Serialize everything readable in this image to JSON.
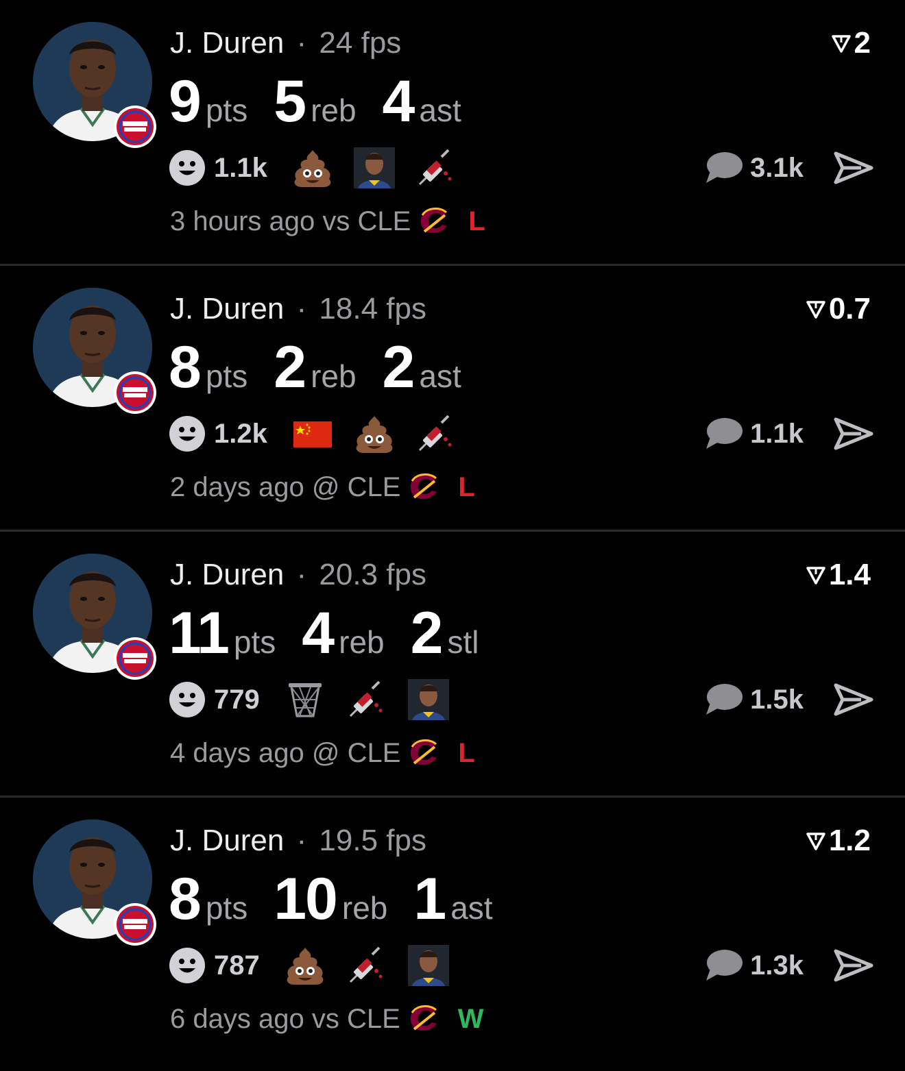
{
  "colors": {
    "loss": "#e0242e",
    "win": "#2fb85a",
    "muted": "#9a9a9f"
  },
  "posts": [
    {
      "player": "J. Duren",
      "fps": "24 fps",
      "rating": "2",
      "stats": [
        {
          "value": "9",
          "label": "pts"
        },
        {
          "value": "5",
          "label": "reb"
        },
        {
          "value": "4",
          "label": "ast"
        }
      ],
      "reaction_count": "1.1k",
      "emojis": [
        "poop-emoji",
        "player-face-emoji",
        "syringe-emoji"
      ],
      "comments": "3.1k",
      "time": "3 hours ago",
      "location": "vs",
      "opponent": "CLE",
      "result": "L",
      "result_type": "loss"
    },
    {
      "player": "J. Duren",
      "fps": "18.4 fps",
      "rating": "0.7",
      "stats": [
        {
          "value": "8",
          "label": "pts"
        },
        {
          "value": "2",
          "label": "reb"
        },
        {
          "value": "2",
          "label": "ast"
        }
      ],
      "reaction_count": "1.2k",
      "emojis": [
        "china-flag-emoji",
        "poop-emoji",
        "syringe-emoji"
      ],
      "comments": "1.1k",
      "time": "2 days ago",
      "location": "@",
      "opponent": "CLE",
      "result": "L",
      "result_type": "loss"
    },
    {
      "player": "J. Duren",
      "fps": "20.3 fps",
      "rating": "1.4",
      "stats": [
        {
          "value": "11",
          "label": "pts"
        },
        {
          "value": "4",
          "label": "reb"
        },
        {
          "value": "2",
          "label": "stl"
        }
      ],
      "reaction_count": "779",
      "emojis": [
        "basket-emoji",
        "syringe-emoji",
        "player-face-emoji"
      ],
      "comments": "1.5k",
      "time": "4 days ago",
      "location": "@",
      "opponent": "CLE",
      "result": "L",
      "result_type": "loss"
    },
    {
      "player": "J. Duren",
      "fps": "19.5 fps",
      "rating": "1.2",
      "stats": [
        {
          "value": "8",
          "label": "pts"
        },
        {
          "value": "10",
          "label": "reb"
        },
        {
          "value": "1",
          "label": "ast"
        }
      ],
      "reaction_count": "787",
      "emojis": [
        "poop-emoji",
        "syringe-emoji",
        "player-face-emoji"
      ],
      "comments": "1.3k",
      "time": "6 days ago",
      "location": "vs",
      "opponent": "CLE",
      "result": "W",
      "result_type": "win"
    }
  ]
}
